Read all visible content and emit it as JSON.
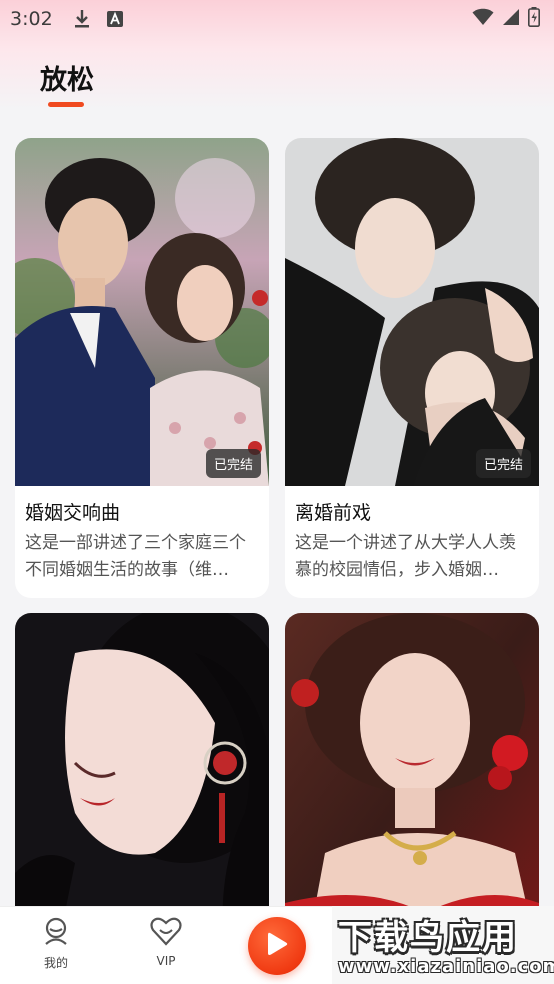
{
  "status_bar": {
    "time": "3:02",
    "icons": [
      "download-icon",
      "keyboard-icon",
      "wifi-icon",
      "signal-icon",
      "battery-icon"
    ]
  },
  "page": {
    "title": "放松"
  },
  "colors": {
    "accent": "#f04a20",
    "badge_bg": "#282828"
  },
  "cards": [
    {
      "title": "婚姻交响曲",
      "description": "这是一部讲述了三个家庭三个不同婚姻生活的故事（维…",
      "status": "已完结"
    },
    {
      "title": "离婚前戏",
      "description": "这是一个讲述了从大学人人羡慕的校园情侣，步入婚姻…",
      "status": "已完结"
    },
    {
      "title": "",
      "description": "",
      "status": ""
    },
    {
      "title": "",
      "description": "",
      "status": ""
    }
  ],
  "nav": {
    "items": [
      {
        "label": "我的",
        "icon": "user-icon"
      },
      {
        "label": "VIP",
        "icon": "vip-heart-icon"
      },
      {
        "label": "",
        "icon": "play-icon"
      }
    ]
  },
  "watermark": {
    "main": "下载鸟应用",
    "url": "www.xiazainiao.com"
  }
}
